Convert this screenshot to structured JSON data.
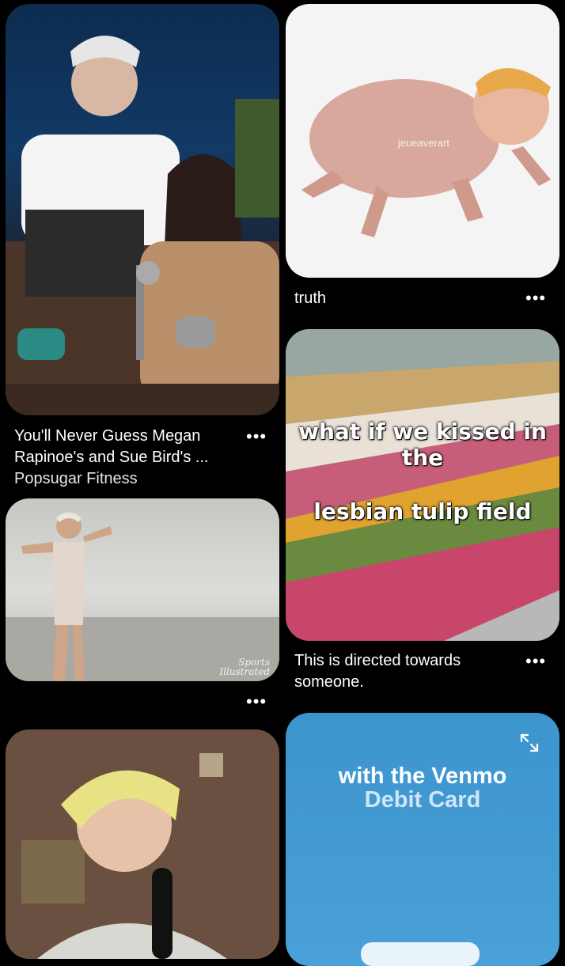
{
  "pins": {
    "rapinoe_bird": {
      "title_line1": "You'll Never Guess Megan",
      "title_line2": "Rapinoe's and Sue Bird's ...",
      "source": "Popsugar Fitness",
      "more": "•••"
    },
    "rat": {
      "watermark": "jeueaverart",
      "title": "truth",
      "more": "•••"
    },
    "tulip": {
      "overlay_line1": "what if we kissed in the",
      "overlay_line2": "lesbian tulip field",
      "title_line1": "This is directed towards",
      "title_line2": "someone.",
      "more": "•••"
    },
    "beach": {
      "watermark_line1": "Sports",
      "watermark_line2": "Illustrated",
      "more": "•••"
    },
    "venmo": {
      "headline": "with the Venmo",
      "subline": "Debit Card",
      "accent": "#3d95ce",
      "icon": "expand-icon"
    },
    "microphone": {}
  }
}
